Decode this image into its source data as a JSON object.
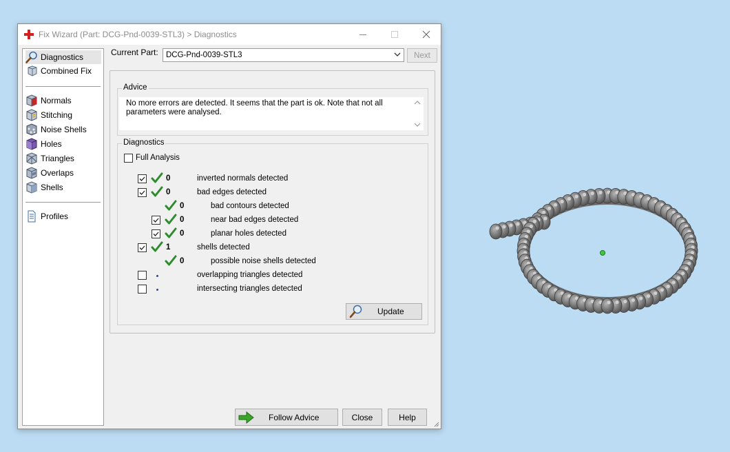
{
  "window": {
    "title": "Fix Wizard (Part: DCG-Pnd-0039-STL3) > Diagnostics",
    "controls": {
      "minimize": "—",
      "maximize": "☐",
      "close": "✕"
    }
  },
  "sidebar": {
    "items": [
      {
        "label": "Diagnostics",
        "icon": "magnifier-icon",
        "active": true
      },
      {
        "label": "Combined Fix",
        "icon": "cube-stack-icon"
      },
      {
        "label": "Normals",
        "icon": "cube-red-icon"
      },
      {
        "label": "Stitching",
        "icon": "cube-stitch-icon"
      },
      {
        "label": "Noise Shells",
        "icon": "noise-cube-icon"
      },
      {
        "label": "Holes",
        "icon": "cube-purple-icon"
      },
      {
        "label": "Triangles",
        "icon": "cube-triangles-icon"
      },
      {
        "label": "Overlaps",
        "icon": "cube-overlap-icon"
      },
      {
        "label": "Shells",
        "icon": "cube-shells-icon"
      },
      {
        "label": "Profiles",
        "icon": "document-icon"
      }
    ]
  },
  "current_part": {
    "label": "Current Part:",
    "value": "DCG-Pnd-0039-STL3",
    "next_label": "Next"
  },
  "advice": {
    "title": "Advice",
    "text": "No more errors are detected. It seems that the part is ok. Note that not all parameters were analysed."
  },
  "diagnostics": {
    "title": "Diagnostics",
    "full_analysis_label": "Full Analysis",
    "rows": [
      {
        "checked": true,
        "status": "ok",
        "count": "0",
        "label": "inverted normals detected"
      },
      {
        "checked": true,
        "status": "ok",
        "count": "0",
        "label": "bad edges detected"
      },
      {
        "checkbox": false,
        "status": "ok",
        "count": "0",
        "label": "bad contours detected"
      },
      {
        "checked": true,
        "status": "ok",
        "count": "0",
        "label": "near bad edges detected"
      },
      {
        "checked": true,
        "status": "ok",
        "count": "0",
        "label": "planar holes detected"
      },
      {
        "checked": true,
        "status": "ok",
        "count": "1",
        "label": "shells detected"
      },
      {
        "checkbox": false,
        "status": "ok",
        "count": "0",
        "label": "possible noise shells detected"
      },
      {
        "checked": false,
        "status": "none",
        "count": "",
        "label": "overlapping triangles detected"
      },
      {
        "checked": false,
        "status": "none",
        "count": "",
        "label": "intersecting triangles detected"
      }
    ],
    "update_label": "Update"
  },
  "footer": {
    "follow_advice_label": "Follow Advice",
    "close_label": "Close",
    "help_label": "Help"
  },
  "colors": {
    "desktop": "#bcdcf4",
    "check_green": "#2e8b2e",
    "arrow_green": "#3aa52a",
    "part_gray": "#8c8c8c",
    "app_red": "#d62020"
  }
}
